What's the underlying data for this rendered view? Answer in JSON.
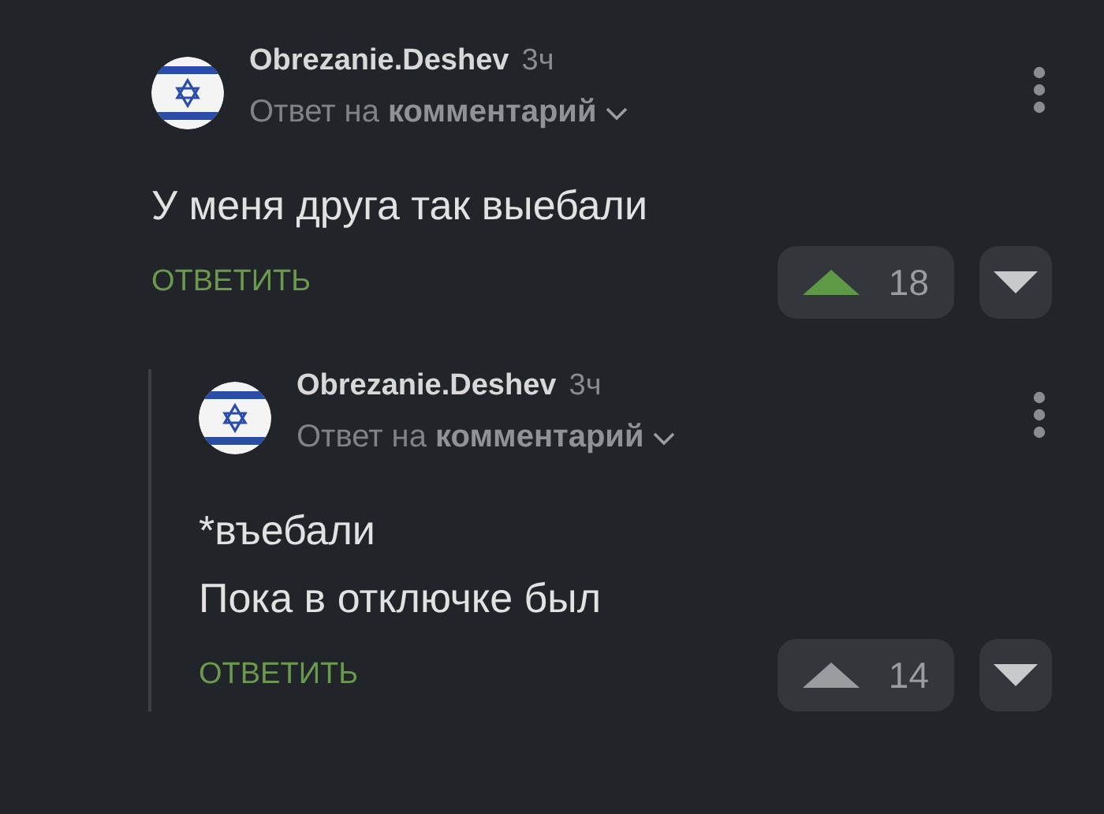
{
  "comments": [
    {
      "author": "Obrezanie.Deshev",
      "time": "3ч",
      "reply_prefix": "Ответ на",
      "reply_target": "комментарий",
      "lines": [
        "У меня друга так выебали"
      ],
      "reply_label": "ОТВЕТИТЬ",
      "rating": "18",
      "upvoted": true,
      "children": [
        {
          "author": "Obrezanie.Deshev",
          "time": "3ч",
          "reply_prefix": "Ответ на",
          "reply_target": "комментарий",
          "lines": [
            "*въебали",
            "Пока в отключке был"
          ],
          "reply_label": "ОТВЕТИТЬ",
          "rating": "14",
          "upvoted": false
        }
      ]
    }
  ]
}
